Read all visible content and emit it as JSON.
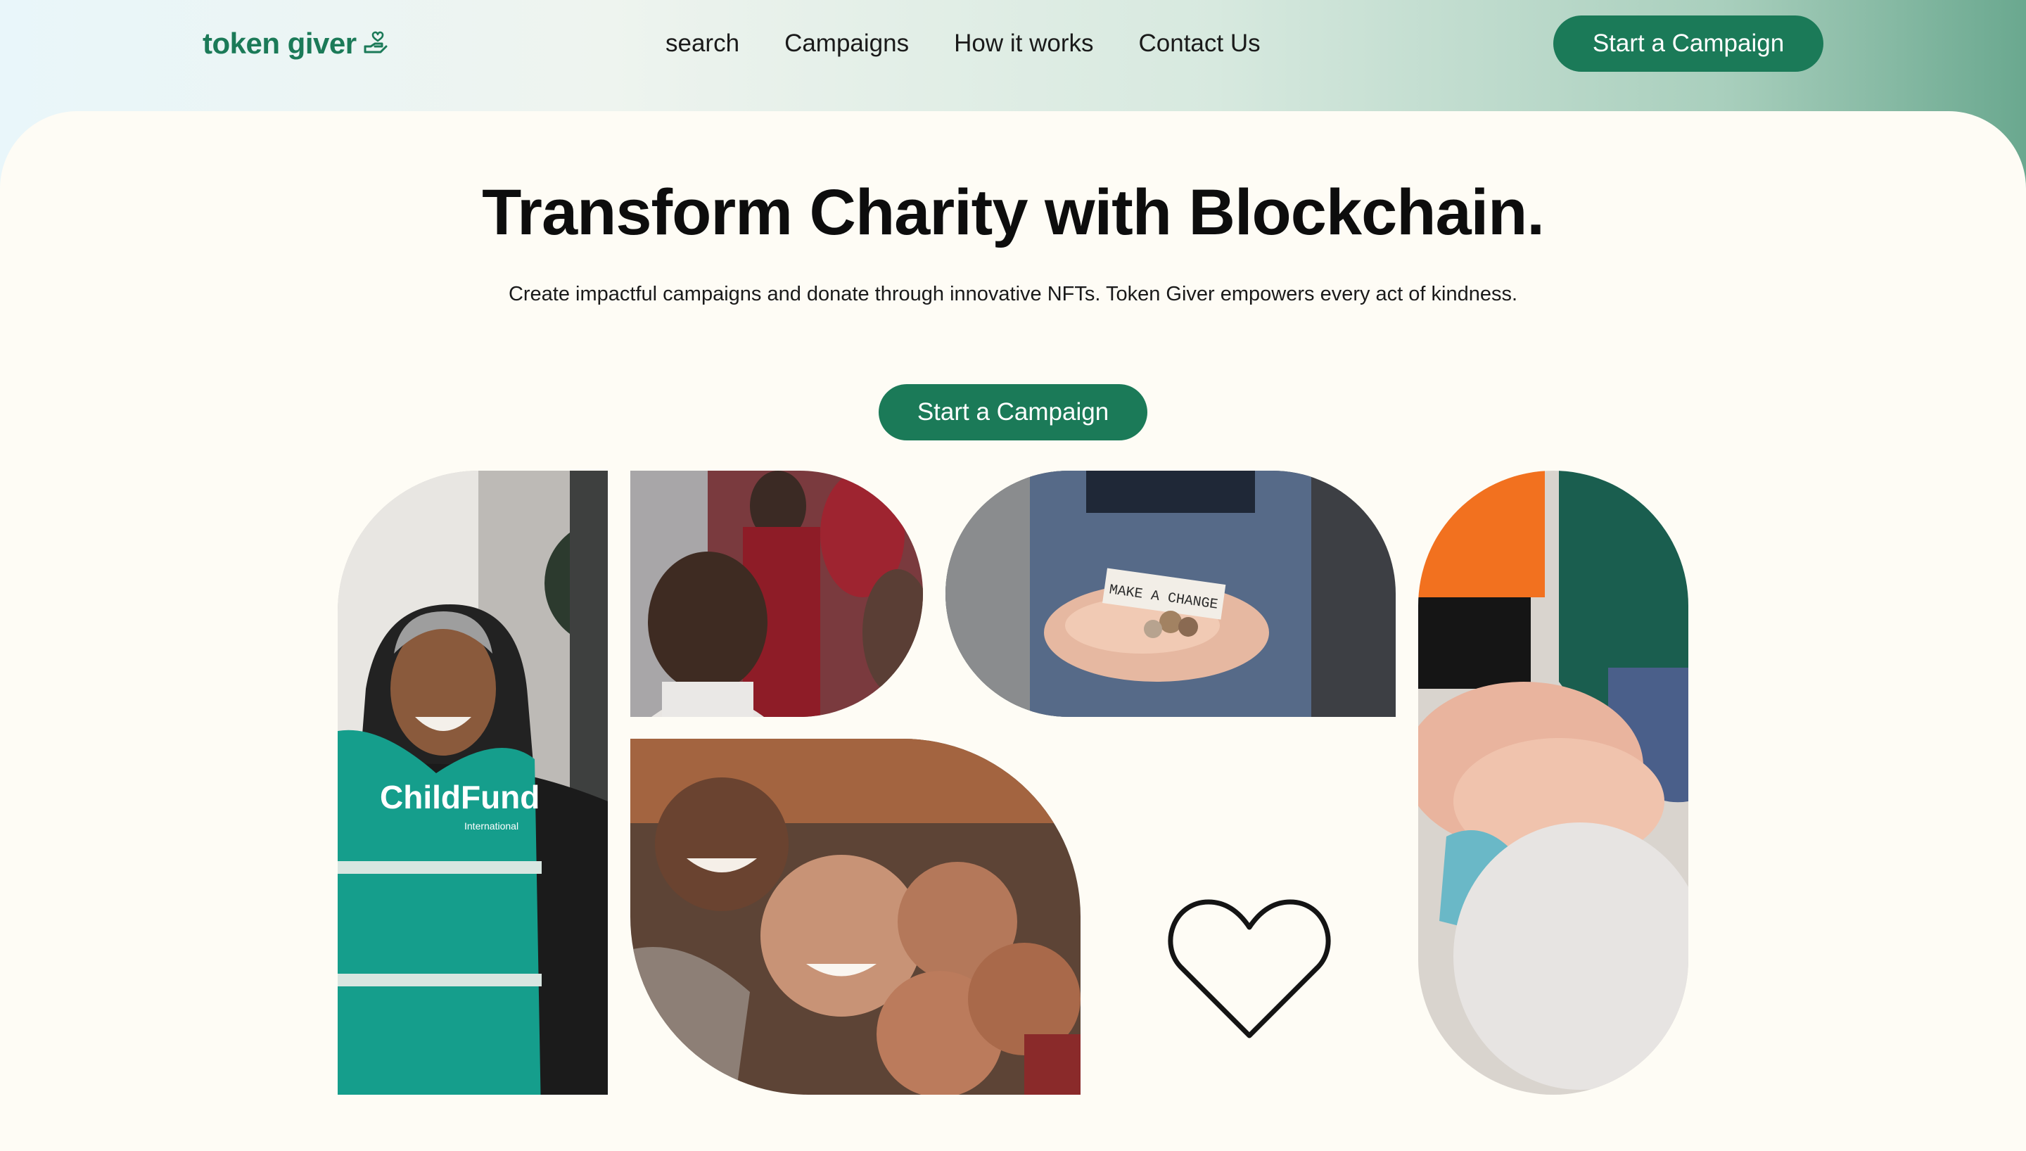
{
  "brand": {
    "logo_text": "token giver",
    "accent": "#1b7a58"
  },
  "nav": {
    "items": [
      "search",
      "Campaigns",
      "How it works",
      "Contact Us"
    ],
    "cta_label": "Start a Campaign"
  },
  "hero": {
    "title": "Transform Charity with Blockchain.",
    "subtitle": "Create impactful campaigns and donate through innovative NFTs. Token Giver empowers every act of kindness.",
    "cta_label": "Start a Campaign"
  },
  "collage": {
    "vest_text": "ChildFund",
    "vest_subtext": "International",
    "note_text": "MAKE A CHANGE",
    "icon": "heart-outline-icon"
  }
}
